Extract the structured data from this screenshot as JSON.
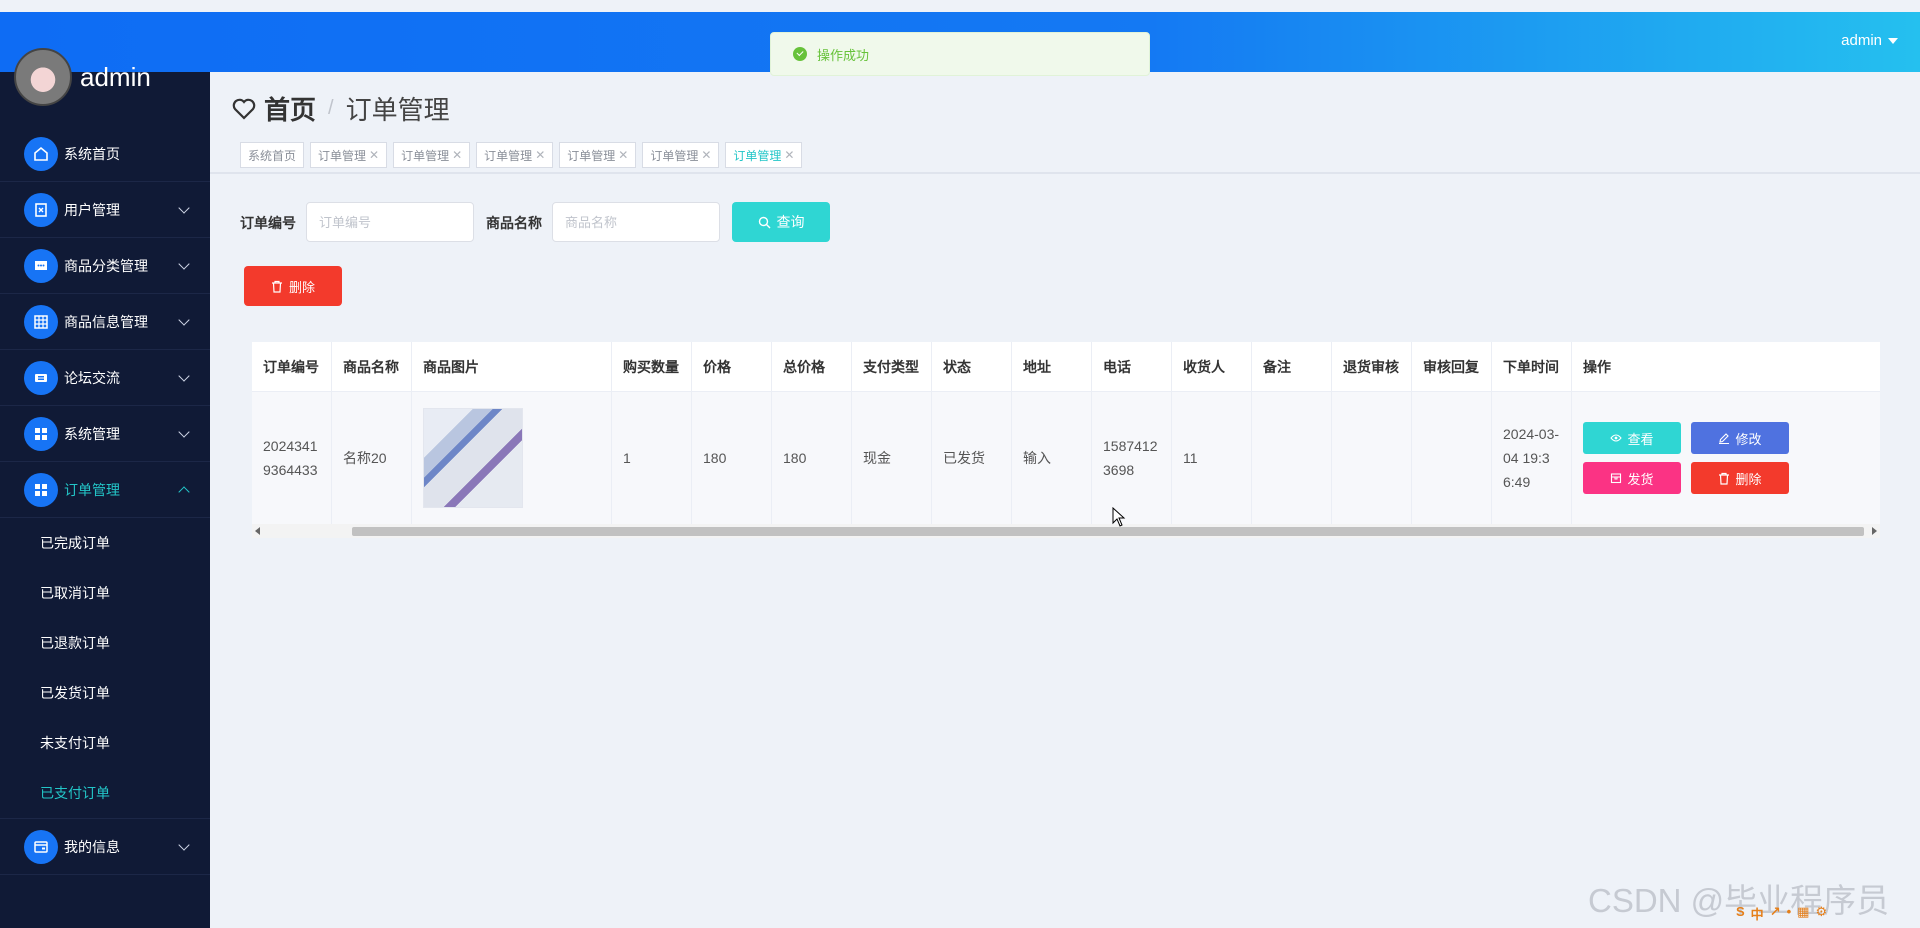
{
  "header": {
    "user": "admin"
  },
  "sidebar": {
    "username": "admin",
    "items": [
      {
        "label": "系统首页",
        "icon": "home-icon"
      },
      {
        "label": "用户管理",
        "icon": "user-icon"
      },
      {
        "label": "商品分类管理",
        "icon": "category-icon"
      },
      {
        "label": "商品信息管理",
        "icon": "grid-icon"
      },
      {
        "label": "论坛交流",
        "icon": "forum-icon"
      },
      {
        "label": "系统管理",
        "icon": "apps-icon"
      },
      {
        "label": "订单管理",
        "icon": "apps-icon"
      },
      {
        "label": "我的信息",
        "icon": "card-icon"
      }
    ],
    "submenu": [
      "已完成订单",
      "已取消订单",
      "已退款订单",
      "已发货订单",
      "未支付订单",
      "已支付订单"
    ]
  },
  "breadcrumb": {
    "home": "首页",
    "separator": "/",
    "current": "订单管理"
  },
  "tags": [
    "系统首页",
    "订单管理",
    "订单管理",
    "订单管理",
    "订单管理",
    "订单管理",
    "订单管理"
  ],
  "search": {
    "order_no_label": "订单编号",
    "order_no_placeholder": "订单编号",
    "product_label": "商品名称",
    "product_placeholder": "商品名称",
    "query_label": "查询",
    "delete_label": "删除"
  },
  "table": {
    "columns": [
      "订单编号",
      "商品名称",
      "商品图片",
      "购买数量",
      "价格",
      "总价格",
      "支付类型",
      "状态",
      "地址",
      "电话",
      "收货人",
      "备注",
      "退货审核",
      "审核回复",
      "下单时间",
      "操作"
    ],
    "rows": [
      {
        "order_no": "20243419364433",
        "product": "名称20",
        "quantity": "1",
        "price": "180",
        "total": "180",
        "pay_type": "现金",
        "status": "已发货",
        "address": "输入",
        "phone": "15874123698",
        "receiver": "11",
        "remark": "",
        "return_review": "",
        "review_reply": "",
        "time": "2024-03-04 19:36:49"
      }
    ],
    "actions": {
      "view": "查看",
      "edit": "修改",
      "ship": "发货",
      "delete": "删除"
    }
  },
  "toast": {
    "message": "操作成功"
  },
  "watermark": "CSDN @毕业程序员",
  "ime": [
    "S",
    "中",
    "↗",
    "•",
    "▦",
    "⚙"
  ],
  "colors": {
    "primary": "#1774f5",
    "accent": "#23c6c8",
    "danger": "#f33a2c",
    "sidebar": "#101a36"
  }
}
